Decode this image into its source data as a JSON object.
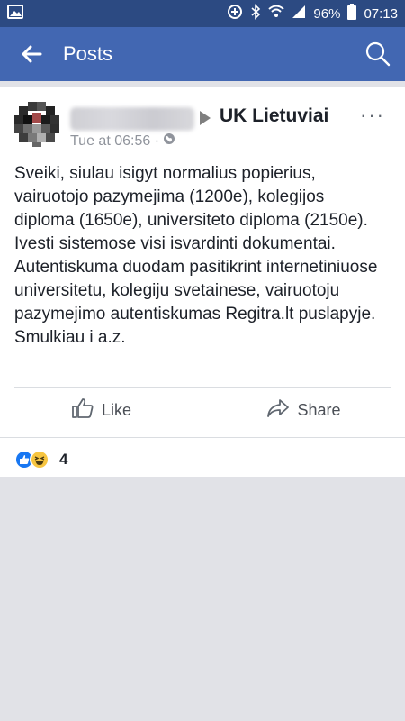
{
  "status_bar": {
    "battery": "96%",
    "time": "07:13",
    "icons": [
      "image-icon",
      "data-saver-icon",
      "bluetooth-icon",
      "wifi-icon",
      "signal-icon",
      "battery-icon"
    ]
  },
  "app_bar": {
    "title": "Posts",
    "back_icon": "back-arrow-icon",
    "search_icon": "search-icon"
  },
  "post": {
    "author": "",
    "group": "UK Lietuviai",
    "timestamp": "Tue at 06:56 ·",
    "privacy_icon": "globe-icon",
    "text": "Sveiki, siulau isigyt normalius popierius, vairuotojo pazymejima (1200e), kolegijos diploma (1650e), universiteto diploma (2150e). Ivesti sistemose visi isvardinti dokumentai. Autentiskuma duodam pasitikrint internetiniuose universitetu, kolegiju svetainese, vairuotoju pazymejimo autentiskumas Regitra.lt puslapyje. Smulkiau i a.z.",
    "actions": {
      "like": "Like",
      "share": "Share"
    },
    "reaction_count": "4"
  },
  "colors": {
    "status_bar": "#2c4a82",
    "app_bar": "#4267b2",
    "background": "#e1e2e7",
    "like_blue": "#1877f2",
    "haha_yellow": "#f7c540"
  }
}
